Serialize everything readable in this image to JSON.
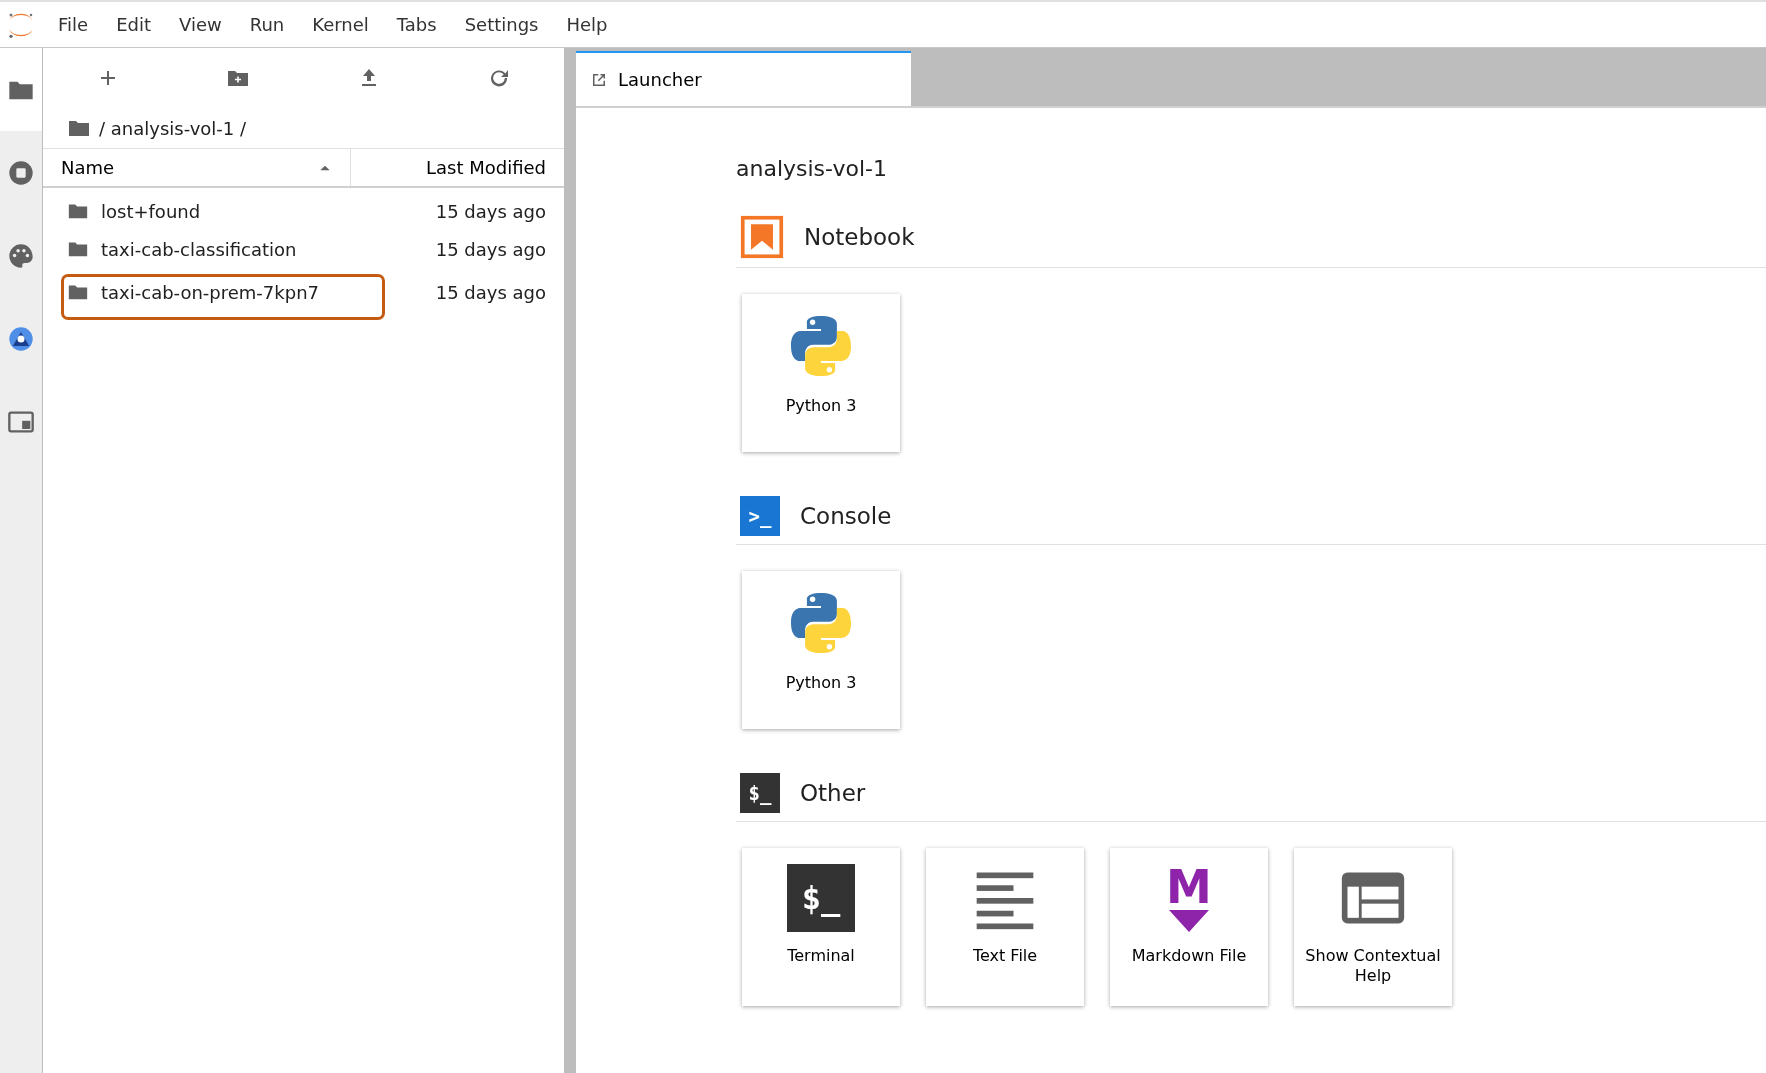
{
  "menu": [
    "File",
    "Edit",
    "View",
    "Run",
    "Kernel",
    "Tabs",
    "Settings",
    "Help"
  ],
  "sidebar_tabs": [
    {
      "kind": "folder",
      "selected": true
    },
    {
      "kind": "running",
      "selected": false
    },
    {
      "kind": "palette",
      "selected": false
    },
    {
      "kind": "extension",
      "selected": false
    },
    {
      "kind": "tabs",
      "selected": false
    }
  ],
  "file_browser": {
    "breadcrumb": "/ analysis-vol-1 /",
    "columns": [
      {
        "label": "Name",
        "sorted": true
      },
      {
        "label": "Last Modified",
        "sorted": false
      }
    ],
    "items": [
      {
        "name": "lost+found",
        "modified": "15 days ago",
        "highlighted": false
      },
      {
        "name": "taxi-cab-classification",
        "modified": "15 days ago",
        "highlighted": false
      },
      {
        "name": "taxi-cab-on-prem-7kpn7",
        "modified": "15 days ago",
        "highlighted": true
      }
    ]
  },
  "tabs": [
    {
      "label": "Launcher",
      "selected": true
    }
  ],
  "launcher": {
    "title": "analysis-vol-1",
    "sections": [
      {
        "kind": "notebook",
        "title": "Notebook",
        "cards": [
          {
            "kind": "python",
            "label": "Python 3"
          }
        ]
      },
      {
        "kind": "console",
        "title": "Console",
        "glyph": ">_",
        "cards": [
          {
            "kind": "python",
            "label": "Python 3"
          }
        ]
      },
      {
        "kind": "other",
        "title": "Other",
        "glyph": "$_",
        "cards": [
          {
            "kind": "terminal",
            "label": "Terminal",
            "glyph": "$_"
          },
          {
            "kind": "text",
            "label": "Text File"
          },
          {
            "kind": "markdown",
            "label": "Markdown File",
            "glyph": "M"
          },
          {
            "kind": "help",
            "label": "Show Contextual Help"
          }
        ]
      }
    ]
  }
}
